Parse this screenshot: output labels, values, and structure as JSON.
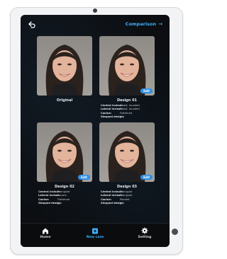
{
  "header": {
    "compare_label": "Comparison"
  },
  "cards": [
    {
      "title": "Original",
      "badge": "",
      "specs": []
    },
    {
      "title": "Design 01",
      "badge": "Edit",
      "specs": [
        {
          "label": "Central incisor:",
          "value": "Ovoid, rounded"
        },
        {
          "label": "Lateral incisor:",
          "value": "Ovoid, rounded"
        },
        {
          "label": "Canine:",
          "value": "Flattened"
        },
        {
          "label": "Stepped design:",
          "value": "(+)"
        }
      ]
    },
    {
      "title": "Design 02",
      "badge": "Edit",
      "specs": [
        {
          "label": "Central incisor:",
          "value": "Triangular"
        },
        {
          "label": "Lateral incisor:",
          "value": "Square"
        },
        {
          "label": "Canine:",
          "value": "Flattened"
        },
        {
          "label": "Stepped design:",
          "value": "(-)"
        }
      ]
    },
    {
      "title": "Design 03",
      "badge": "Edit",
      "specs": [
        {
          "label": "Central incisor:",
          "value": "Triangular"
        },
        {
          "label": "Lateral incisor:",
          "value": "Triangular"
        },
        {
          "label": "Canine:",
          "value": "Pointed"
        },
        {
          "label": "Stepped design:",
          "value": "(-)"
        }
      ]
    }
  ],
  "nav": [
    {
      "label": "Home",
      "icon": "home-icon",
      "active": false
    },
    {
      "label": "New case",
      "icon": "new-case-icon",
      "active": true
    },
    {
      "label": "Setting",
      "icon": "gear-icon",
      "active": false
    }
  ],
  "colors": {
    "accent": "#3fb0ff",
    "badge": "#2f8fe6",
    "screen_bg": "#0c0e11"
  }
}
